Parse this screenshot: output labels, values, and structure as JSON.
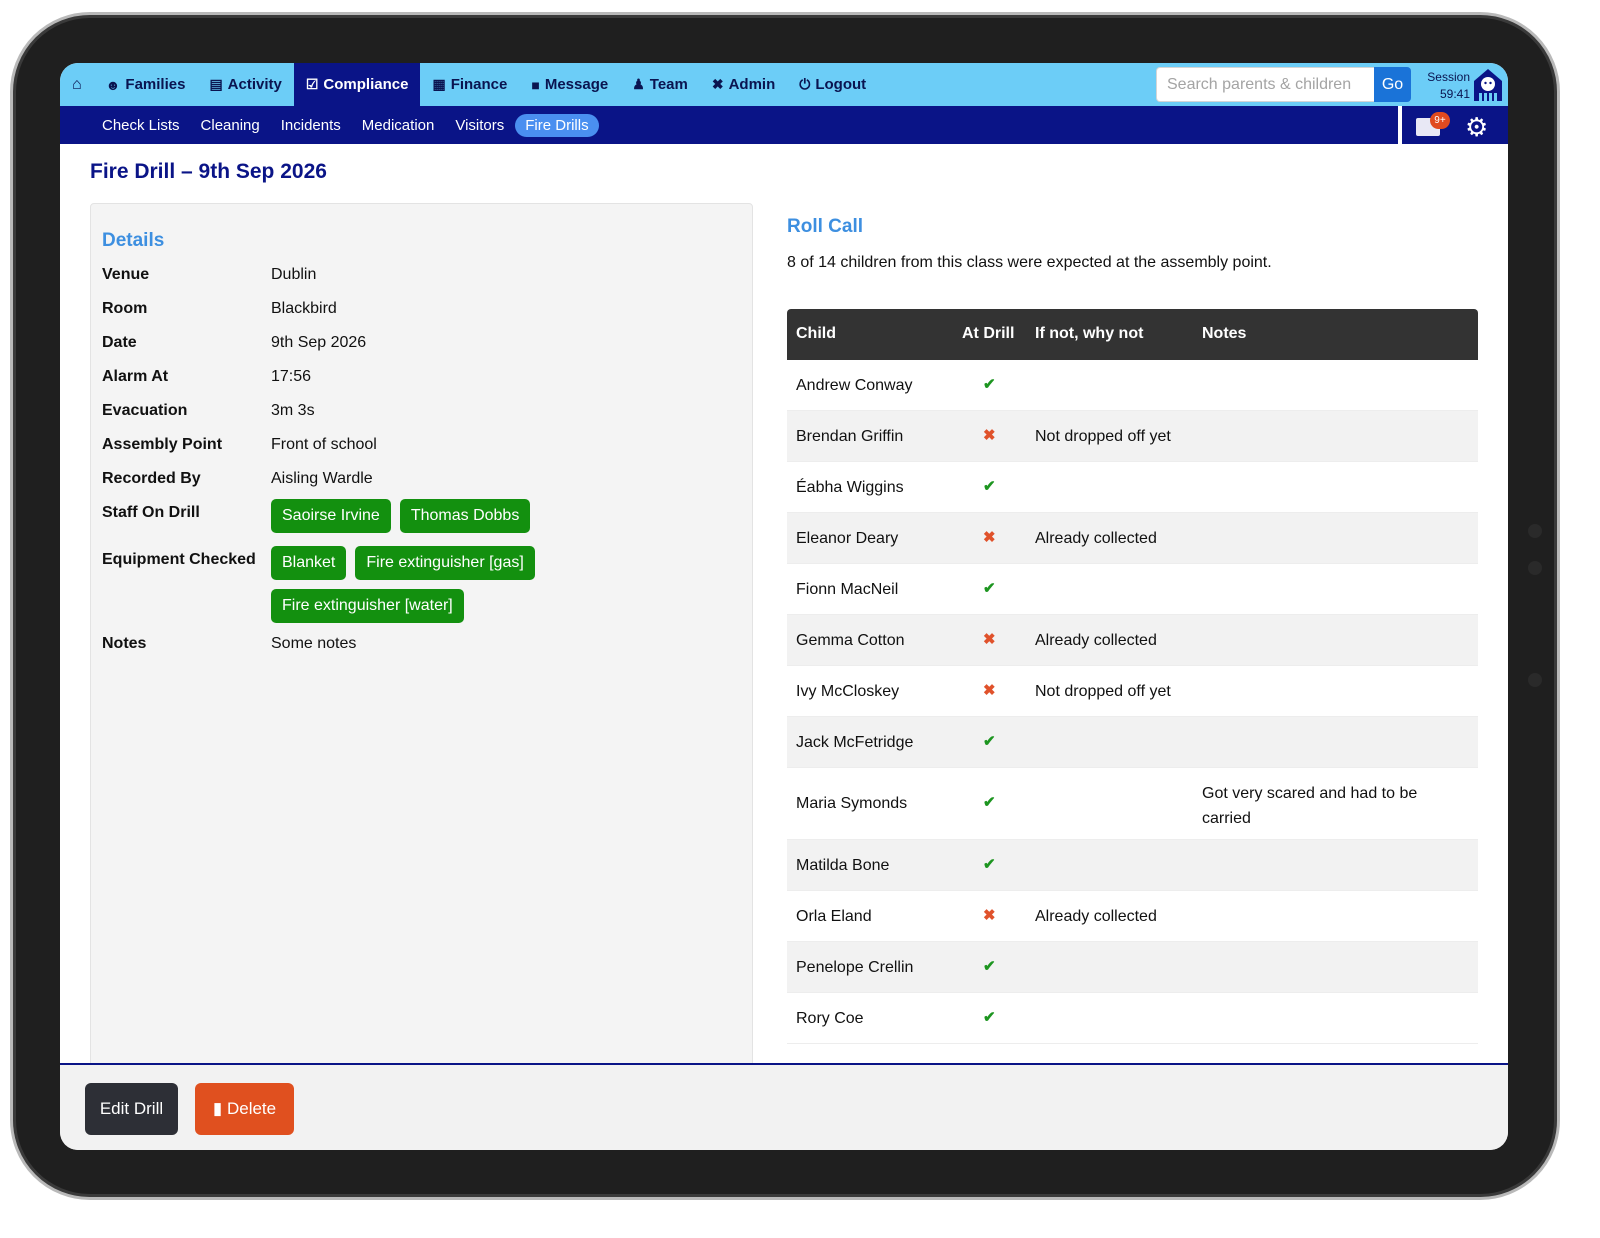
{
  "nav": {
    "items": [
      {
        "label": "Families",
        "icon": "person-icon"
      },
      {
        "label": "Activity",
        "icon": "clipboard-icon"
      },
      {
        "label": "Compliance",
        "icon": "checklist-icon"
      },
      {
        "label": "Finance",
        "icon": "money-icon"
      },
      {
        "label": "Message",
        "icon": "chat-icon"
      },
      {
        "label": "Team",
        "icon": "person-icon"
      },
      {
        "label": "Admin",
        "icon": "tools-icon"
      },
      {
        "label": "Logout",
        "icon": "power-icon"
      }
    ],
    "active": "Compliance",
    "search_placeholder": "Search parents & children",
    "go_label": "Go",
    "session_label": "Session",
    "session_time": "59:41"
  },
  "subnav": {
    "items": [
      "Check Lists",
      "Cleaning",
      "Incidents",
      "Medication",
      "Visitors",
      "Fire Drills"
    ],
    "active": "Fire Drills",
    "badge": "9+"
  },
  "page": {
    "title": "Fire Drill – 9th Sep 2026"
  },
  "details": {
    "title": "Details",
    "rows": [
      {
        "label": "Venue",
        "value": "Dublin"
      },
      {
        "label": "Room",
        "value": "Blackbird"
      },
      {
        "label": "Date",
        "value": "9th Sep 2026"
      },
      {
        "label": "Alarm At",
        "value": "17:56"
      },
      {
        "label": "Evacuation",
        "value": "3m 3s"
      },
      {
        "label": "Assembly Point",
        "value": "Front of school"
      },
      {
        "label": "Recorded By",
        "value": "Aisling Wardle"
      }
    ],
    "staff_label": "Staff On Drill",
    "staff": [
      "Saoirse Irvine",
      "Thomas Dobbs"
    ],
    "equipment_label": "Equipment Checked",
    "equipment": [
      "Blanket",
      "Fire extinguisher [gas]",
      "Fire extinguisher [water]"
    ],
    "notes_label": "Notes",
    "notes": "Some notes"
  },
  "roll_call": {
    "title": "Roll Call",
    "summary": "8 of 14 children from this class were expected at the assembly point.",
    "headers": [
      "Child",
      "At Drill",
      "If not, why not",
      "Notes"
    ],
    "rows": [
      {
        "child": "Andrew Conway",
        "at_drill": true,
        "why": "",
        "notes": ""
      },
      {
        "child": "Brendan Griffin",
        "at_drill": false,
        "why": "Not dropped off yet",
        "notes": ""
      },
      {
        "child": "Éabha Wiggins",
        "at_drill": true,
        "why": "",
        "notes": ""
      },
      {
        "child": "Eleanor Deary",
        "at_drill": false,
        "why": "Already collected",
        "notes": ""
      },
      {
        "child": "Fionn MacNeil",
        "at_drill": true,
        "why": "",
        "notes": ""
      },
      {
        "child": "Gemma Cotton",
        "at_drill": false,
        "why": "Already collected",
        "notes": ""
      },
      {
        "child": "Ivy McCloskey",
        "at_drill": false,
        "why": "Not dropped off yet",
        "notes": ""
      },
      {
        "child": "Jack McFetridge",
        "at_drill": true,
        "why": "",
        "notes": ""
      },
      {
        "child": "Maria Symonds",
        "at_drill": true,
        "why": "",
        "notes": "Got very scared and had to be carried"
      },
      {
        "child": "Matilda Bone",
        "at_drill": true,
        "why": "",
        "notes": ""
      },
      {
        "child": "Orla Eland",
        "at_drill": false,
        "why": "Already collected",
        "notes": ""
      },
      {
        "child": "Penelope Crellin",
        "at_drill": true,
        "why": "",
        "notes": ""
      },
      {
        "child": "Rory Coe",
        "at_drill": true,
        "why": "",
        "notes": ""
      }
    ]
  },
  "footer": {
    "edit_label": "Edit Drill",
    "delete_label": "Delete"
  },
  "colors": {
    "nav_bg": "#6ccdf7",
    "navy": "#0a1487",
    "tag_green": "#13900f",
    "delete_orange": "#e0501f",
    "accent_blue": "#3d8fe0"
  }
}
